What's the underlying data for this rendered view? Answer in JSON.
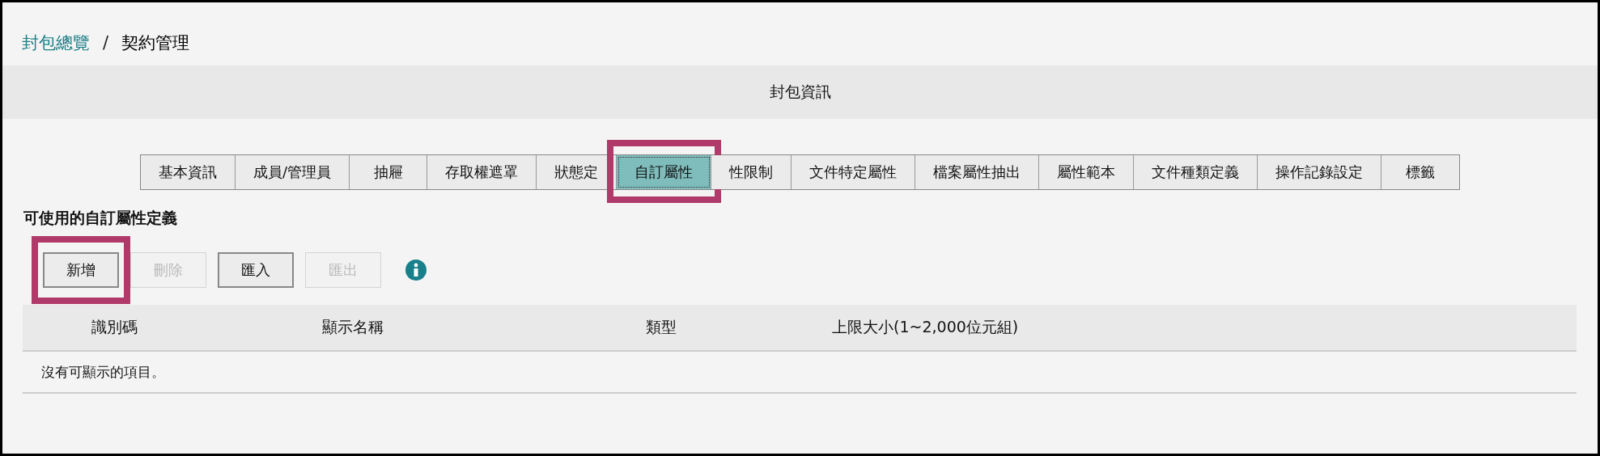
{
  "breadcrumb": [
    {
      "label": "封包總覽",
      "kind": "link"
    },
    {
      "label": "/",
      "kind": "separator"
    },
    {
      "label": "契約管理",
      "kind": "current"
    }
  ],
  "panel_title": "封包資訊",
  "tabs": [
    {
      "label": "基本資訊",
      "selected": false,
      "highlighted": false
    },
    {
      "label": "成員/管理員",
      "selected": false,
      "highlighted": false
    },
    {
      "label": "抽屜",
      "selected": false,
      "highlighted": false
    },
    {
      "label": "存取權遮罩",
      "selected": false,
      "highlighted": false
    },
    {
      "label": "狀態定",
      "selected": false,
      "highlighted": false
    },
    {
      "label": "自訂屬性",
      "selected": true,
      "highlighted": true
    },
    {
      "label": "性限制",
      "selected": false,
      "highlighted": false
    },
    {
      "label": "文件特定屬性",
      "selected": false,
      "highlighted": false
    },
    {
      "label": "檔案屬性抽出",
      "selected": false,
      "highlighted": false
    },
    {
      "label": "屬性範本",
      "selected": false,
      "highlighted": false
    },
    {
      "label": "文件種類定義",
      "selected": false,
      "highlighted": false
    },
    {
      "label": "操作記錄設定",
      "selected": false,
      "highlighted": false
    },
    {
      "label": "標籤",
      "selected": false,
      "highlighted": false
    }
  ],
  "section_title": "可使用的自訂屬性定義",
  "buttons": [
    {
      "label": "新增",
      "disabled": false,
      "highlighted": true
    },
    {
      "label": "刪除",
      "disabled": true,
      "highlighted": false
    },
    {
      "label": "匯入",
      "disabled": false,
      "highlighted": false
    },
    {
      "label": "匯出",
      "disabled": true,
      "highlighted": false
    }
  ],
  "table": {
    "columns": [
      "識別碼",
      "顯示名稱",
      "類型",
      "上限大小(1~2,000位元組)"
    ],
    "empty_message": "沒有可顯示的項目。"
  }
}
